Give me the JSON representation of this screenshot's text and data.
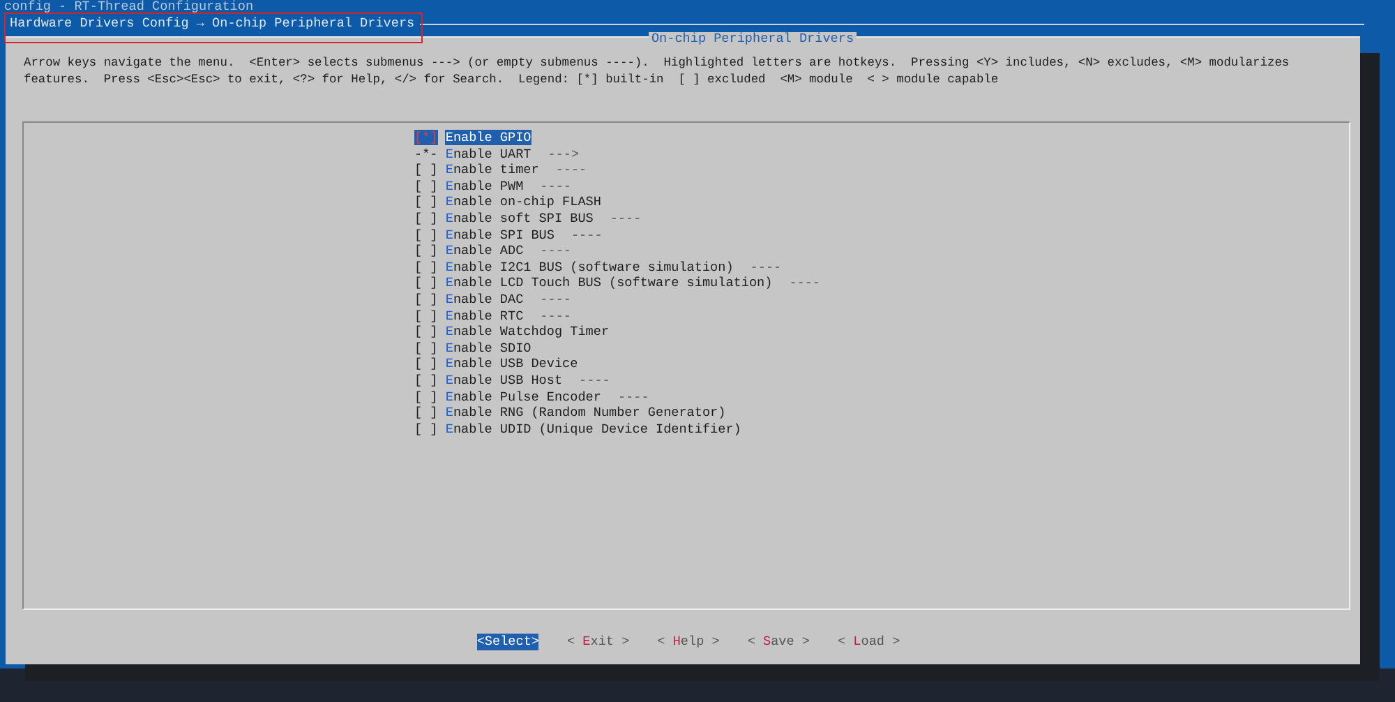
{
  "window": {
    "title": "config - RT-Thread Configuration"
  },
  "breadcrumb": {
    "text": "Hardware Drivers Config → On-chip Peripheral Drivers",
    "annotated": true
  },
  "dialog": {
    "title": "On-chip Peripheral Drivers",
    "help_lines": [
      "Arrow keys navigate the menu.  <Enter> selects submenus ---> (or empty submenus ----).  Highlighted letters are hotkeys.  Pressing <Y> includes, <N> excludes, <M> modularizes",
      "features.  Press <Esc><Esc> to exit, <?> for Help, </> for Search.  Legend: [*] built-in  [ ] excluded  <M> module  < > module capable"
    ],
    "items": [
      {
        "box": "[*]",
        "hotkey": "E",
        "label": "nable GPIO",
        "selected": true
      },
      {
        "box": "-*-",
        "hotkey": "E",
        "label": "nable UART",
        "suffix": "--->",
        "selected": false
      },
      {
        "box": "[ ]",
        "hotkey": "E",
        "label": "nable timer",
        "suffix": "----",
        "selected": false
      },
      {
        "box": "[ ]",
        "hotkey": "E",
        "label": "nable PWM",
        "suffix": "----",
        "selected": false
      },
      {
        "box": "[ ]",
        "hotkey": "E",
        "label": "nable on-chip FLASH",
        "selected": false
      },
      {
        "box": "[ ]",
        "hotkey": "E",
        "label": "nable soft SPI BUS",
        "suffix": "----",
        "selected": false
      },
      {
        "box": "[ ]",
        "hotkey": "E",
        "label": "nable SPI BUS",
        "suffix": "----",
        "selected": false
      },
      {
        "box": "[ ]",
        "hotkey": "E",
        "label": "nable ADC",
        "suffix": "----",
        "selected": false
      },
      {
        "box": "[ ]",
        "hotkey": "E",
        "label": "nable I2C1 BUS (software simulation)",
        "suffix": "----",
        "selected": false
      },
      {
        "box": "[ ]",
        "hotkey": "E",
        "label": "nable LCD Touch BUS (software simulation)",
        "suffix": "----",
        "selected": false
      },
      {
        "box": "[ ]",
        "hotkey": "E",
        "label": "nable DAC",
        "suffix": "----",
        "selected": false
      },
      {
        "box": "[ ]",
        "hotkey": "E",
        "label": "nable RTC",
        "suffix": "----",
        "selected": false
      },
      {
        "box": "[ ]",
        "hotkey": "E",
        "label": "nable Watchdog Timer",
        "selected": false
      },
      {
        "box": "[ ]",
        "hotkey": "E",
        "label": "nable SDIO",
        "selected": false
      },
      {
        "box": "[ ]",
        "hotkey": "E",
        "label": "nable USB Device",
        "selected": false
      },
      {
        "box": "[ ]",
        "hotkey": "E",
        "label": "nable USB Host",
        "suffix": "----",
        "selected": false
      },
      {
        "box": "[ ]",
        "hotkey": "E",
        "label": "nable Pulse Encoder",
        "suffix": "----",
        "selected": false
      },
      {
        "box": "[ ]",
        "hotkey": "E",
        "label": "nable RNG (Random Number Generator)",
        "selected": false
      },
      {
        "box": "[ ]",
        "hotkey": "E",
        "label": "nable UDID (Unique Device Identifier)",
        "selected": false
      }
    ],
    "buttons": [
      {
        "open": "<",
        "hotkey": "S",
        "label": "elect",
        "close": ">",
        "selected": true
      },
      {
        "open": "< ",
        "hotkey": "E",
        "label": "xit",
        "close": " >",
        "selected": false
      },
      {
        "open": "< ",
        "hotkey": "H",
        "label": "elp",
        "close": " >",
        "selected": false
      },
      {
        "open": "< ",
        "hotkey": "S",
        "label": "ave",
        "close": " >",
        "selected": false
      },
      {
        "open": "< ",
        "hotkey": "L",
        "label": "oad",
        "close": " >",
        "selected": false
      }
    ]
  }
}
